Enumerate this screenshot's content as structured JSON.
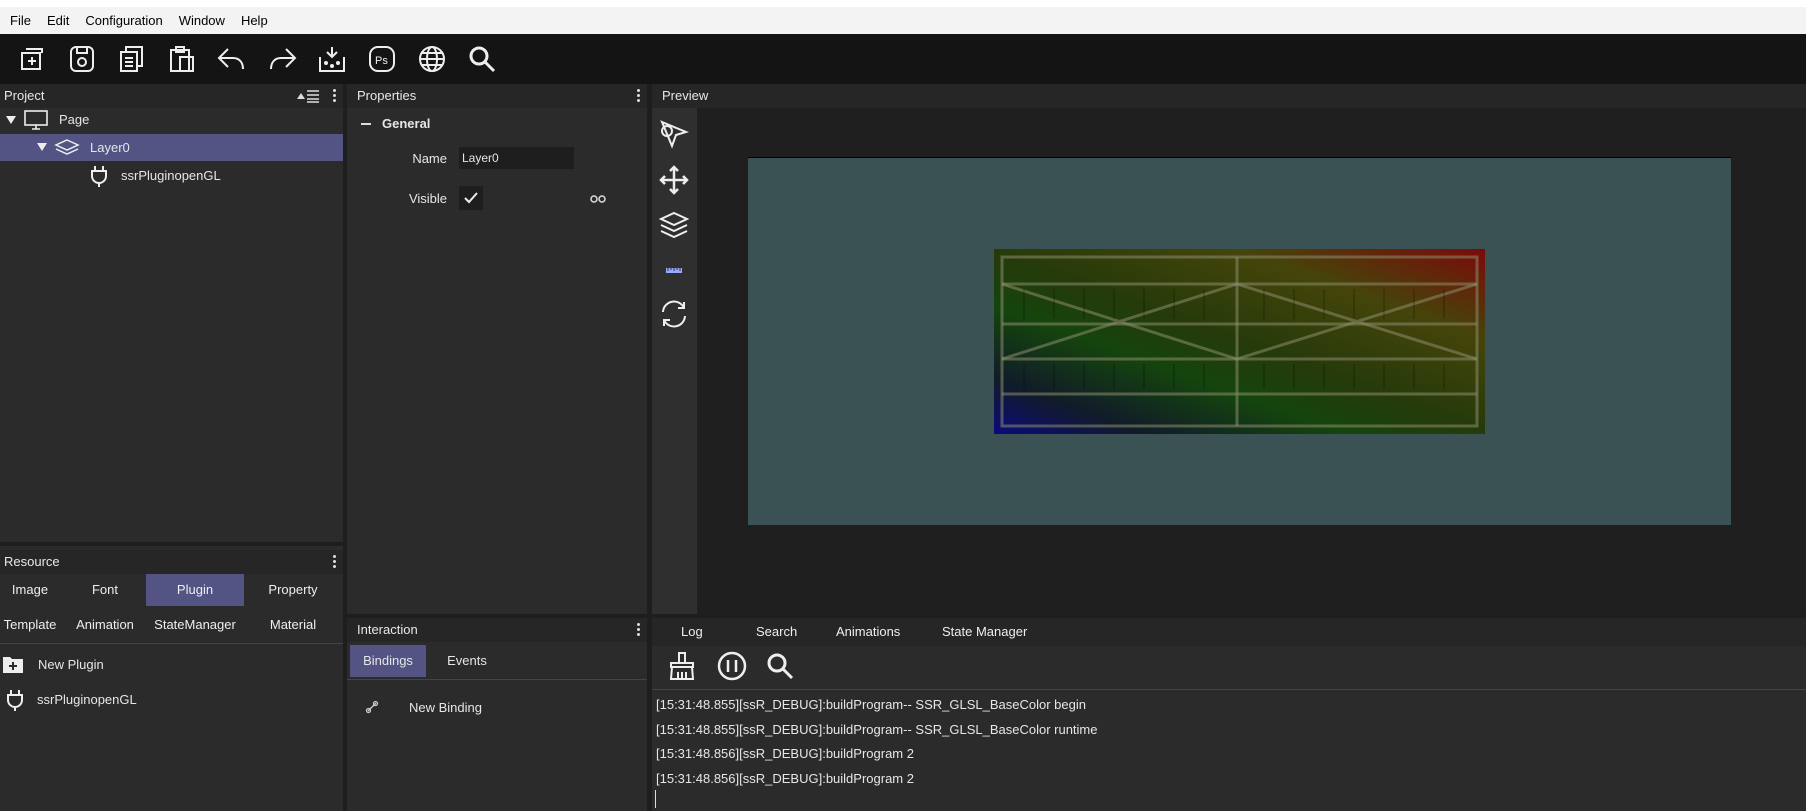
{
  "menubar": {
    "items": [
      "File",
      "Edit",
      "Configuration",
      "Window",
      "Help"
    ]
  },
  "toolbar": {
    "icons": [
      "new-page-icon",
      "save-icon",
      "copy-icon",
      "paste-icon",
      "undo-icon",
      "redo-icon",
      "export-icon",
      "photoshop-icon",
      "globe-icon",
      "search-icon"
    ],
    "ps_label": "Ps"
  },
  "project": {
    "title": "Project",
    "tree": [
      {
        "label": "Page"
      },
      {
        "label": "Layer0"
      },
      {
        "label": "ssrPluginopenGL"
      }
    ]
  },
  "resource": {
    "title": "Resource",
    "tabs": [
      "Image",
      "Font",
      "Plugin",
      "Property",
      "Template",
      "Animation",
      "StateManager",
      "Material"
    ],
    "active_tab": "Plugin",
    "new_label": "New Plugin",
    "items": [
      "ssrPluginopenGL"
    ]
  },
  "properties": {
    "title": "Properties",
    "group": "General",
    "name_label": "Name",
    "name_value": "Layer0",
    "visible_label": "Visible"
  },
  "interaction": {
    "title": "Interaction",
    "tabs": [
      "Bindings",
      "Events"
    ],
    "active_tab": "Bindings",
    "new_binding": "New Binding"
  },
  "preview": {
    "title": "Preview"
  },
  "log": {
    "tabs": [
      "Log",
      "Search",
      "Animations",
      "State Manager"
    ],
    "lines": [
      "[15:31:48.855][ssR_DEBUG]:buildProgram-- SSR_GLSL_BaseColor  begin",
      "[15:31:48.855][ssR_DEBUG]:buildProgram-- SSR_GLSL_BaseColor  runtime",
      "[15:31:48.856][ssR_DEBUG]:buildProgram 2",
      "[15:31:48.856][ssR_DEBUG]:buildProgram 2"
    ]
  }
}
